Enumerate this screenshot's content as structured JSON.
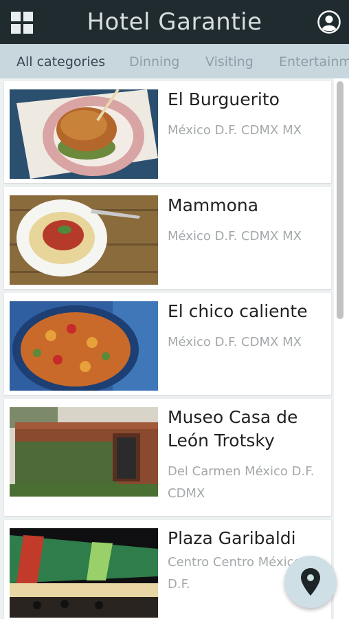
{
  "app": {
    "title": "Hotel Garantie",
    "menu_icon": "grid-menu-icon",
    "profile_icon": "user-profile-icon"
  },
  "categories": [
    {
      "label": "All categories",
      "active": true
    },
    {
      "label": "Dinning",
      "active": false
    },
    {
      "label": "Visiting",
      "active": false
    },
    {
      "label": "Entertainm",
      "active": false
    }
  ],
  "places": [
    {
      "name": "El Burguerito",
      "address": "México D.F. CDMX MX",
      "image": "burger-photo"
    },
    {
      "name": "Mammona",
      "address": "México D.F. CDMX MX",
      "image": "spaghetti-photo"
    },
    {
      "name": "El chico caliente",
      "address": "México D.F. CDMX MX",
      "image": "rice-dish-photo"
    },
    {
      "name": "Museo Casa de León Trotsky",
      "address": "Del Carmen México D.F. CDMX",
      "image": "museum-photo"
    },
    {
      "name": "Plaza Garibaldi",
      "address": "Centro Centro México D.F.",
      "image": "plaza-photo"
    }
  ],
  "fab": {
    "icon": "map-pin-icon"
  },
  "colors": {
    "appbar": "#1f2b2f",
    "tabbar": "#c8d7de",
    "title_text": "#d7dde0",
    "address_text": "#a4a8aa",
    "fab": "#cfdfe6"
  }
}
